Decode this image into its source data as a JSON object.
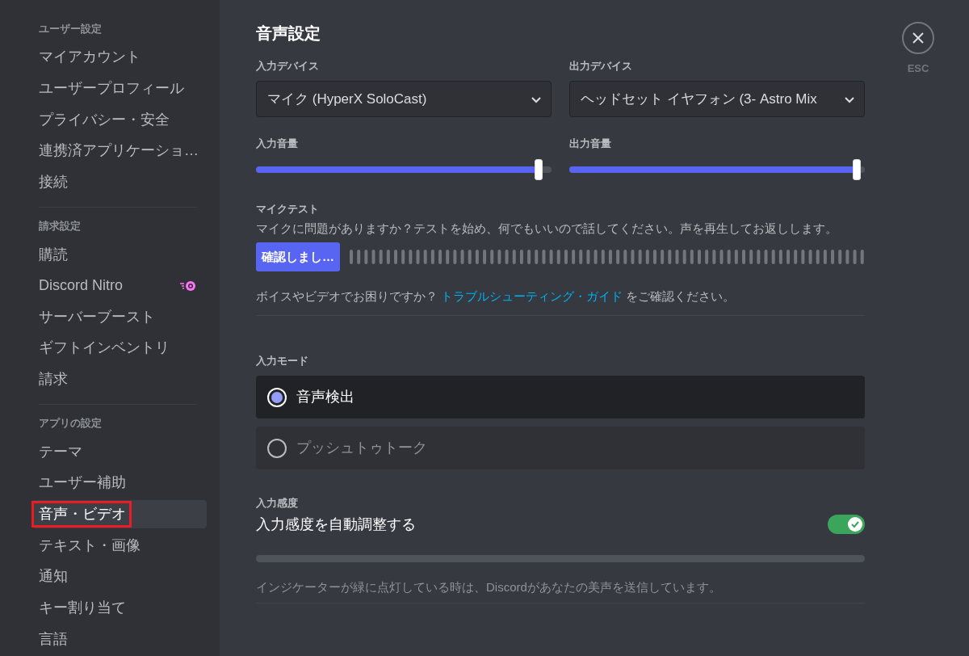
{
  "sidebar": {
    "sections": [
      {
        "header": "ユーザー設定",
        "items": [
          {
            "label": "マイアカウント",
            "selected": false
          },
          {
            "label": "ユーザープロフィール",
            "selected": false
          },
          {
            "label": "プライバシー・安全",
            "selected": false
          },
          {
            "label": "連携済アプリケーショ…",
            "selected": false
          },
          {
            "label": "接続",
            "selected": false
          }
        ]
      },
      {
        "header": "請求設定",
        "items": [
          {
            "label": "購読",
            "selected": false
          },
          {
            "label": "Discord Nitro",
            "selected": false,
            "has_icon": true
          },
          {
            "label": "サーバーブースト",
            "selected": false
          },
          {
            "label": "ギフトインベントリ",
            "selected": false
          },
          {
            "label": "請求",
            "selected": false
          }
        ]
      },
      {
        "header": "アプリの設定",
        "items": [
          {
            "label": "テーマ",
            "selected": false
          },
          {
            "label": "ユーザー補助",
            "selected": false
          },
          {
            "label": "音声・ビデオ",
            "selected": true,
            "annotated": true
          },
          {
            "label": "テキスト・画像",
            "selected": false
          },
          {
            "label": "通知",
            "selected": false
          },
          {
            "label": "キー割り当て",
            "selected": false
          },
          {
            "label": "言語",
            "selected": false
          }
        ]
      }
    ]
  },
  "title": "音声設定",
  "close": {
    "label": "ESC"
  },
  "devices": [
    {
      "label": "入力デバイス",
      "value": "マイク (HyperX SoloCast)",
      "volume_label": "入力音量",
      "level": 0.97
    },
    {
      "label": "出力デバイス",
      "value": "ヘッドセット イヤフォン (3- Astro Mix",
      "volume_label": "出力音量",
      "level": 0.985
    }
  ],
  "mic_test": {
    "label": "マイクテスト",
    "description": "マイクに問題がありますか？テストを始め、何でもいいので話してください。声を再生してお返しします。",
    "button": "確認しまし…"
  },
  "help": {
    "before": "ボイスやビデオでお困りですか？ ",
    "link": "トラブルシューティング・ガイド",
    "after": " をご確認ください。"
  },
  "input_mode": {
    "label": "入力モード",
    "options": [
      {
        "label": "音声検出",
        "selected": true
      },
      {
        "label": "プッシュトゥトーク",
        "selected": false
      }
    ]
  },
  "sensitivity": {
    "label": "入力感度",
    "toggle_label": "入力感度を自動調整する",
    "on": true,
    "note": "インジケーターが緑に点灯している時は、Discordがあなたの美声を送信しています。"
  }
}
